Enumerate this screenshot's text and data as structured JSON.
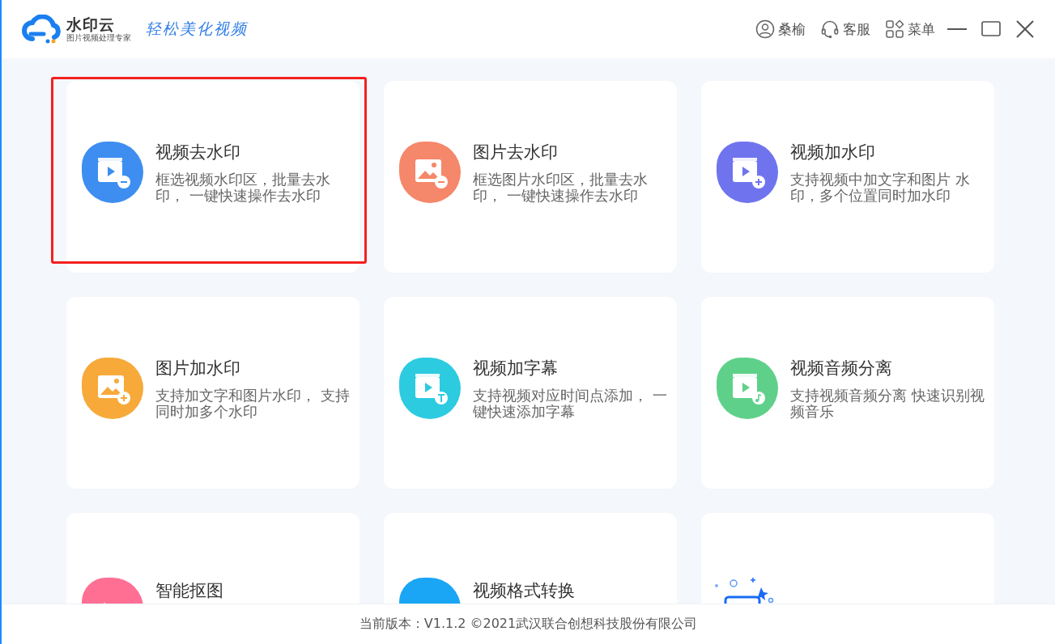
{
  "header": {
    "brand": "水印云",
    "brand_tagline": "图片视频处理专家",
    "slogan": "轻松美化视频",
    "actions": [
      {
        "kind": "user",
        "label": "桑榆"
      },
      {
        "kind": "support",
        "label": "客服"
      },
      {
        "kind": "menu",
        "label": "菜单"
      }
    ]
  },
  "cards": [
    {
      "kind": "videoremove",
      "color": "#3d8ef0",
      "title": "视频去水印",
      "description": "框选视频水印区，批量去水印， 一键快速操作去水印",
      "selected": true
    },
    {
      "kind": "imageremove",
      "color": "#f5876a",
      "title": "图片去水印",
      "description": "框选图片水印区，批量去水印， 一键快速操作去水印",
      "selected": false
    },
    {
      "kind": "videoadd",
      "color": "#6f74ee",
      "title": "视频加水印",
      "description": "支持视频中加文字和图片 水印，多个位置同时加水印",
      "selected": false
    },
    {
      "kind": "imageadd",
      "color": "#f7a93a",
      "title": "图片加水印",
      "description": "支持加文字和图片水印， 支持同时加多个水印",
      "selected": false
    },
    {
      "kind": "subtitle",
      "color": "#2ccbe0",
      "title": "视频加字幕",
      "description": "支持视频对应时间点添加， 一键快速添加字幕",
      "selected": false
    },
    {
      "kind": "audio",
      "color": "#5fd08a",
      "title": "视频音频分离",
      "description": "支持视频音频分离 快速识别视频音乐",
      "selected": false
    },
    {
      "kind": "cutout",
      "color": "#ff6f93",
      "title": "智能抠图",
      "selected": false
    },
    {
      "kind": "convert",
      "color": "#1aa6f5",
      "title": "视频格式转换",
      "selected": false
    },
    {
      "kind": "promo",
      "color": "#1a6cf5",
      "selected": false
    }
  ],
  "footer": {
    "text": "当前版本：V1.1.2 ©2021武汉联合创想科技股份有限公司"
  }
}
